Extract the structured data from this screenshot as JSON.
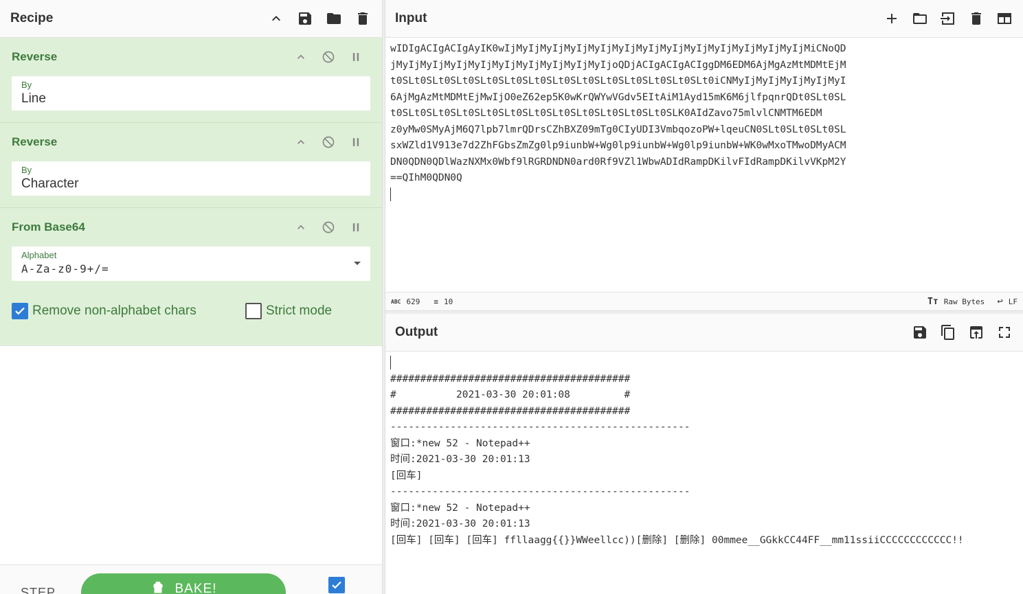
{
  "recipe": {
    "title": "Recipe",
    "operations": [
      {
        "name": "Reverse",
        "arg_label": "By",
        "arg_value": "Line"
      },
      {
        "name": "Reverse",
        "arg_label": "By",
        "arg_value": "Character"
      },
      {
        "name": "From Base64",
        "arg_label": "Alphabet",
        "arg_value": "A-Za-z0-9+/=",
        "options": [
          {
            "label": "Remove non-alphabet chars",
            "checked": true
          },
          {
            "label": "Strict mode",
            "checked": false
          }
        ]
      }
    ],
    "footer": {
      "step_label": "STEP",
      "bake_label": "BAKE!",
      "autobake_checked": true
    }
  },
  "input": {
    "title": "Input",
    "text": "wIDIgACIgACIgAyIK0wIjMyIjMyIjMyIjMyIjMyIjMyIjMyIjMyIjMyIjMyIjMyIjMyIjMiCNoQD\njMyIjMyIjMyIjMyIjMyIjMyIjMyIjMyIjMyIjoQDjACIgACIgACIggDM6EDM6AjMgAzMtMDMtEjM\nt0SLt0SLt0SLt0SLt0SLt0SLt0SLt0SLt0SLt0SLt0SLt0SLt0SLt0iCNMyIjMyIjMyIjMyIjMyI\n6AjMgAzMtMDMtEjMwIjO0eZ62ep5K0wKrQWYwVGdv5EItAiM1Ayd15mK6M6jlfpqnrQDt0SLt0SL\nt0SLt0SLt0SLt0SLt0SLt0SLt0SLt0SLt0SLt0SLt0SLt0SLK0AIdZavo75mlvlCNMTM6EDM\nz0yMw0SMyAjM6Q7lpb7lmrQDrsCZhBXZ09mTg0CIyUDI3VmbqozoPW+lqeuCN0SLt0SLt0SLt0SL\nsxWZld1V913e7d2ZhFGbsZmZg0lp9iunbW+Wg0lp9iunbW+Wg0lp9iunbW+WK0wMxoTMwoDMyACM\nDN0QDN0QDlWazNXMx0Wbf9lRGRDNDN0ard0Rf9VZl1WbwADIdRampDKilvFIdRampDKilvVKpM2Y\n==QIhM0QDN0Q",
    "status": {
      "chars_tag": "ABC",
      "chars": "629",
      "lines": "10",
      "format": "Raw Bytes",
      "eol": "LF"
    }
  },
  "output": {
    "title": "Output",
    "text": "\n########################################\n#          2021-03-30 20:01:08         #\n########################################\n--------------------------------------------------\n窗口:*new 52 - Notepad++\n时间:2021-03-30 20:01:13\n[回车]\n--------------------------------------------------\n窗口:*new 52 - Notepad++\n时间:2021-03-30 20:01:13\n[回车] [回车] [回车] ffllaagg{{}}WWeellcc))[删除] [删除] 00mmee__GGkkCC44FF__mm11ssiiCCCCCCCCCCCC!!"
  },
  "colors": {
    "op_bg": "#dff0d8",
    "op_text": "#3d7a3d",
    "bake": "#5cb85c",
    "checkbox": "#2d7dd6"
  }
}
